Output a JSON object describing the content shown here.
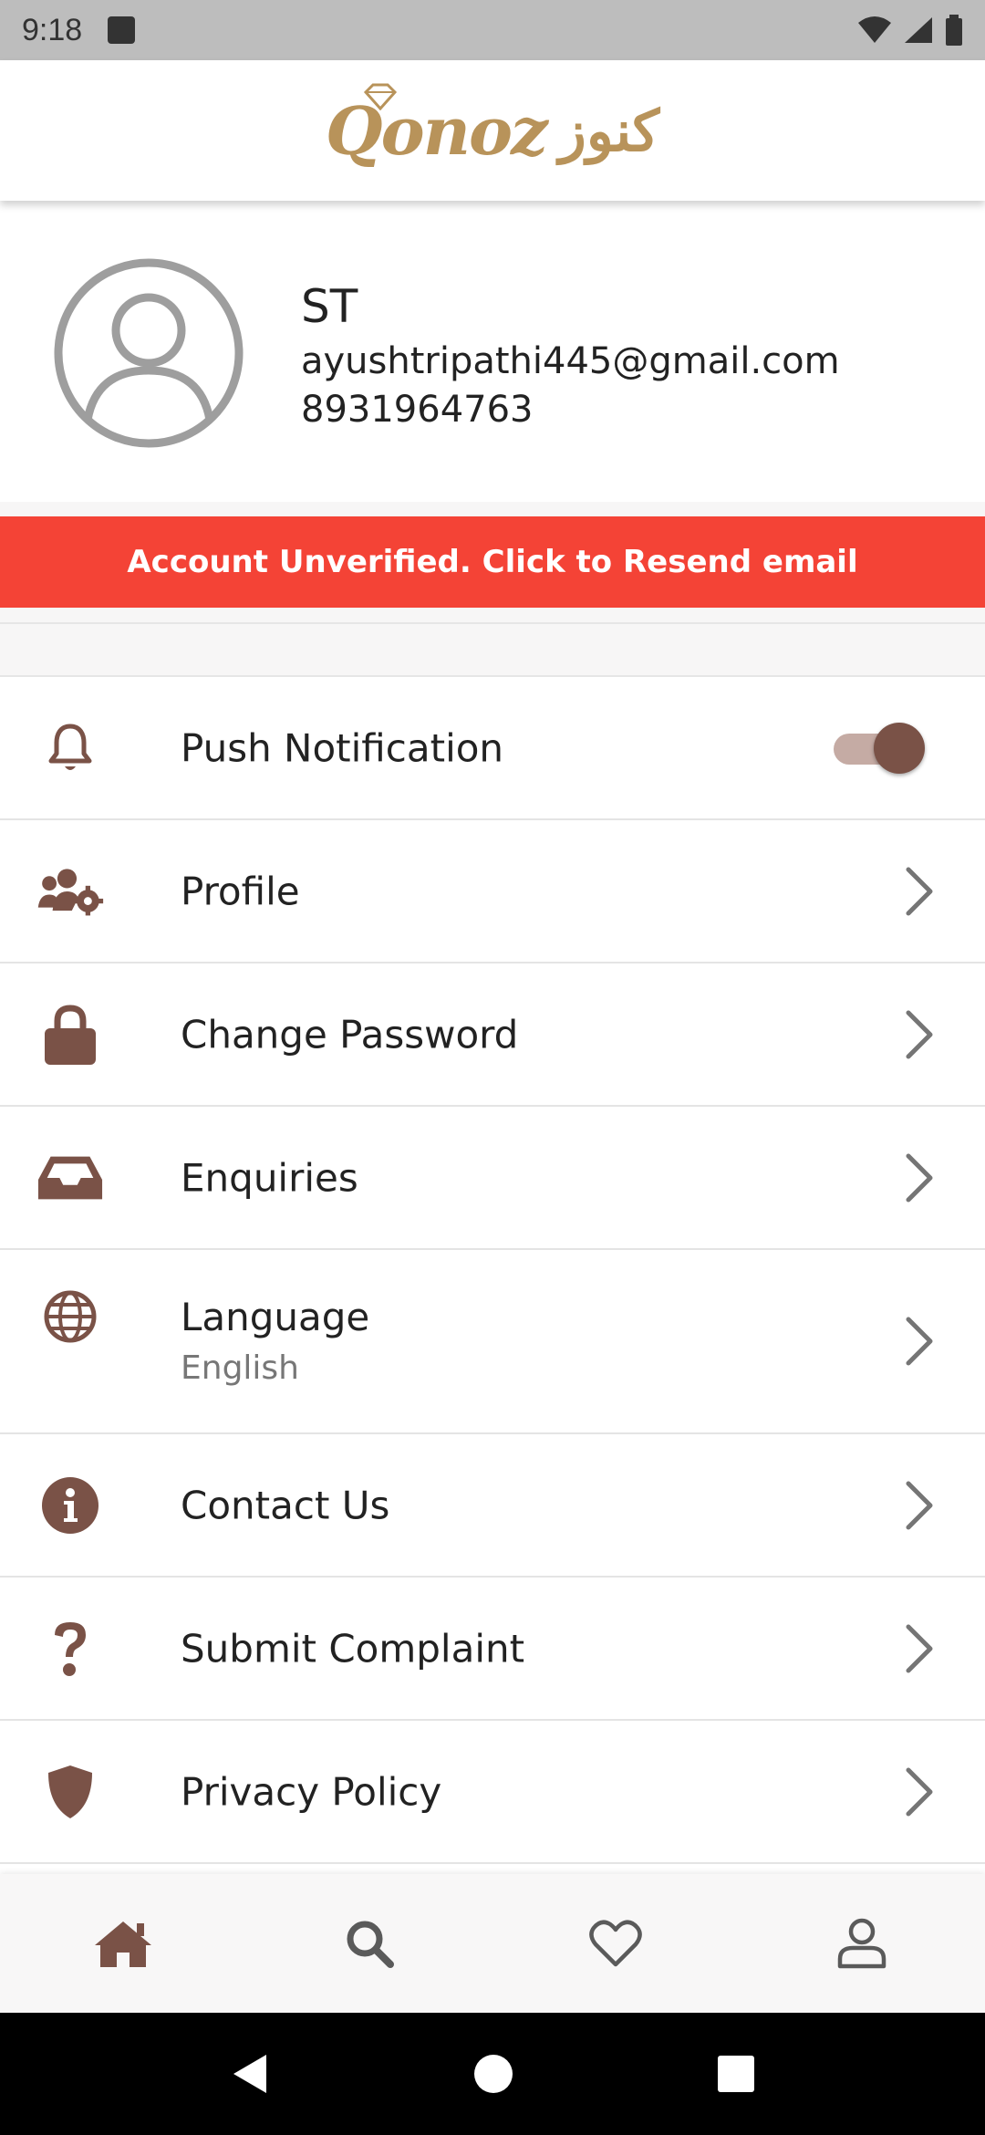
{
  "status_bar": {
    "time": "9:18",
    "icons": [
      "stop-icon",
      "wifi-icon",
      "signal-icon",
      "battery-icon"
    ]
  },
  "header": {
    "logo_text": "Qonoz",
    "logo_arabic": "كنوز",
    "logo_color": "#b8935a"
  },
  "profile": {
    "name": "ST",
    "email": "ayushtripathi445@gmail.com",
    "phone": "8931964763",
    "avatar_icon": "user-circle-icon"
  },
  "banner": {
    "text": "Account Unverified. Click to Resend email",
    "color": "#f44336"
  },
  "settings": {
    "accent_color": "#7a5247",
    "items": [
      {
        "label": "Push Notification",
        "icon": "bell-icon",
        "toggle_on": true
      },
      {
        "label": "Profile",
        "icon": "users-gear-icon"
      },
      {
        "label": "Change Password",
        "icon": "lock-icon"
      },
      {
        "label": "Enquiries",
        "icon": "inbox-icon"
      },
      {
        "label": "Language",
        "sub": "English",
        "icon": "globe-icon"
      },
      {
        "label": "Contact Us",
        "icon": "info-icon"
      },
      {
        "label": "Submit Complaint",
        "icon": "question-icon"
      },
      {
        "label": "Privacy Policy",
        "icon": "shield-icon"
      }
    ]
  },
  "bottom_nav": {
    "items": [
      "home-icon",
      "search-icon",
      "heart-icon",
      "user-icon"
    ],
    "active": "home-icon"
  },
  "system_nav": [
    "back-icon",
    "home-circle-icon",
    "recents-icon"
  ]
}
